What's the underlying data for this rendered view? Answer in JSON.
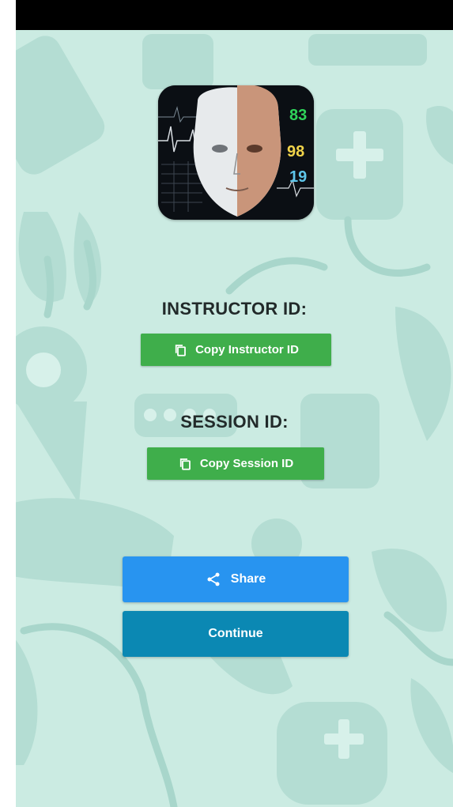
{
  "instructor": {
    "heading": "INSTRUCTOR ID:",
    "copy_label": "Copy Instructor ID"
  },
  "session": {
    "heading": "SESSION ID:",
    "copy_label": "Copy Session ID"
  },
  "actions": {
    "share_label": "Share",
    "continue_label": "Continue"
  },
  "logo": {
    "readouts": [
      "83",
      "98",
      "19"
    ]
  },
  "icons": {
    "copy": "copy-icon",
    "share": "share-icon"
  },
  "colors": {
    "status_bar": "#000000",
    "background": "#cbebe2",
    "copy_button": "#3fae4b",
    "share_button": "#2894f0",
    "continue_button": "#0b88b3"
  }
}
